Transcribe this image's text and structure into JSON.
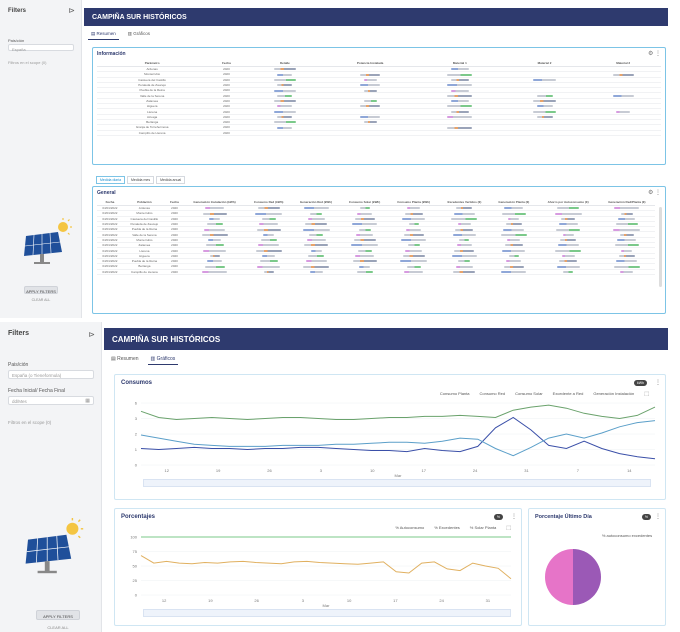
{
  "filters": {
    "title": "Filters",
    "collapse_icon": "chevron-left-icon",
    "pais_label": "Pais/ción",
    "pais_value": "España",
    "pais_tag": "España (o Tieneformula)",
    "fecha_label": "Fecha Inicial/ Fecha Final",
    "fecha_value": "dd/Mes",
    "filtro_link": "Filtros en el scope (0)",
    "apply_button": "APPLY FILTERS",
    "clear_button": "CLEAR ALL"
  },
  "dashboard": {
    "title": "CAMPIÑA SUR HISTÓRICOS",
    "tabs": [
      "Resumen",
      "Gráficos"
    ]
  },
  "informacion": {
    "title": "Información",
    "columns": [
      "Parámetro",
      "Fecha",
      "Detalle",
      "Potencia Instalada",
      "Material 1",
      "Material 2",
      "Material 3"
    ],
    "rows": [
      [
        "Ardenas",
        "2020",
        "a",
        "",
        "b",
        "",
        ""
      ],
      [
        "Monterrubio",
        "2020",
        "b",
        "a",
        "c",
        "",
        "a"
      ],
      [
        "Castuera del Castillo",
        "2020",
        "c",
        "d",
        "a",
        "b",
        ""
      ],
      [
        "Peraleda de Zaucejo",
        "2020",
        "a",
        "b",
        "b",
        "",
        ""
      ],
      [
        "Puebla de la Reina",
        "2020",
        "b",
        "a",
        "d",
        "",
        ""
      ],
      [
        "Valle de la Serena",
        "2020",
        "c",
        "",
        "a",
        "c",
        "b"
      ],
      [
        "Zalamea",
        "2020",
        "a",
        "c",
        "b",
        "a",
        ""
      ],
      [
        "Higuera",
        "2020",
        "d",
        "a",
        "c",
        "b",
        ""
      ],
      [
        "Llerena",
        "2020",
        "b",
        "",
        "a",
        "c",
        "d"
      ],
      [
        "Azuaga",
        "2020",
        "a",
        "b",
        "d",
        "a",
        ""
      ],
      [
        "Berlanga",
        "2020",
        "c",
        "a",
        "",
        "",
        ""
      ],
      [
        "Granja de Torrehermosa",
        "2020",
        "b",
        "",
        "a",
        "",
        ""
      ],
      [
        "Campillo de Llerena",
        "2020",
        "",
        "",
        "",
        "",
        ""
      ]
    ]
  },
  "subtabs": [
    "Medida diaria",
    "Medida mes",
    "Medida anual"
  ],
  "general": {
    "title": "General",
    "columns": [
      "Fecha",
      "Población",
      "Fecha",
      "Generación Instalación (kWh)",
      "Consumo Red (kWh)",
      "Generación Red (kWh)",
      "Consumo Solar (kWh)",
      "Consumo Planta (kWh)",
      "Excedentes Vertidos (€)",
      "Generación Planta (€)",
      "Ahorro por Autoconsumo (€)",
      "Generación Red/Planta (€)"
    ],
    "rows": [
      [
        "04/01/2022",
        "Ardenas",
        "2020"
      ],
      [
        "04/01/2022",
        "Monterrubio",
        "2020"
      ],
      [
        "04/01/2022",
        "Castuera del Castillo",
        "2020"
      ],
      [
        "04/01/2022",
        "Peraleda de Zaucejo",
        "2020"
      ],
      [
        "04/01/2022",
        "Puebla de la Reina",
        "2020"
      ],
      [
        "04/01/2022",
        "Valle de la Serena",
        "2020"
      ],
      [
        "04/01/2022",
        "Monterrubio",
        "2020"
      ],
      [
        "04/01/2022",
        "Zalamea",
        "2020"
      ],
      [
        "04/01/2022",
        "Llerena",
        "2020"
      ],
      [
        "04/01/2022",
        "Higuera",
        "2020"
      ],
      [
        "04/01/2022",
        "Puebla de la Reina",
        "2020"
      ],
      [
        "04/01/2022",
        "Berlanga",
        "2020"
      ],
      [
        "04/01/2022",
        "Campillo de Llerena",
        "2020"
      ]
    ]
  },
  "consumos": {
    "title": "Consumos",
    "legend": [
      "Consumo Planta",
      "Consumo Red",
      "Consumo Solar",
      "Excedente a Red",
      "Generación Instalación"
    ],
    "x_ticks": [
      "12",
      "19",
      "26",
      "3",
      "10",
      "17",
      "24",
      "31",
      "7",
      "14"
    ],
    "x_label": "Mar",
    "y_ticks": [
      "6",
      "3",
      "2",
      "1",
      "0"
    ],
    "badge": "kWh"
  },
  "porcentajes": {
    "title": "Porcentajes",
    "legend": [
      "% Autoconsumo",
      "% Excedentes",
      "% Solar Planta"
    ],
    "x_ticks": [
      "12",
      "19",
      "26",
      "3",
      "10",
      "17",
      "24",
      "31"
    ],
    "x_label": "Mar",
    "y_ticks": [
      "100",
      "75",
      "50",
      "25",
      "0"
    ],
    "badge": "%"
  },
  "pie": {
    "title": "Porcentaje Último Día",
    "badge": "%",
    "label_top": "% autoconsumo excedentes",
    "label_bottom": "% solar planta"
  },
  "chart_data": [
    {
      "type": "line",
      "title": "Consumos",
      "xlabel": "Mar",
      "x": [
        0,
        1,
        2,
        3,
        4,
        5,
        6,
        7,
        8,
        9,
        10,
        11,
        12,
        13,
        14,
        15,
        16,
        17,
        18,
        19,
        20,
        21,
        22,
        23,
        24,
        25,
        26,
        27,
        28,
        29
      ],
      "series": [
        {
          "name": "Consumo Planta",
          "color": "#6aa26c",
          "values": [
            5.2,
            4.6,
            4.4,
            4.5,
            4.6,
            4.5,
            4.4,
            4.5,
            4.6,
            4.6,
            4.5,
            4.4,
            4.4,
            4.5,
            4.6,
            4.6,
            4.7,
            4.7,
            4.8,
            4.7,
            4.6,
            5.3,
            5.6,
            5.8,
            5.5,
            5.0,
            4.7,
            4.5,
            4.8,
            5.6
          ]
        },
        {
          "name": "Consumo Red",
          "color": "#3a4fa8",
          "values": [
            1.6,
            1.5,
            1.6,
            1.7,
            1.6,
            1.6,
            1.5,
            1.6,
            1.6,
            1.7,
            1.7,
            1.6,
            1.5,
            1.4,
            1.4,
            1.3,
            1.6,
            1.4,
            1.3,
            1.8,
            3.6,
            4.6,
            3.4,
            1.9,
            1.6,
            2.3,
            1.6,
            1.1,
            0.8,
            0.6
          ]
        },
        {
          "name": "Consumo Solar",
          "color": "#5b9fc9",
          "values": [
            2.9,
            2.6,
            2.3,
            2.0,
            1.9,
            1.8,
            1.8,
            1.8,
            1.9,
            1.9,
            1.9,
            2.0,
            2.0,
            2.1,
            2.2,
            2.2,
            2.1,
            2.3,
            2.6,
            2.5,
            1.6,
            0.9,
            1.7,
            2.6,
            3.0,
            2.6,
            3.1,
            3.7,
            4.1,
            4.3
          ]
        }
      ]
    },
    {
      "type": "line",
      "title": "Porcentajes",
      "xlabel": "Mar",
      "x": [
        0,
        1,
        2,
        3,
        4,
        5,
        6,
        7,
        8,
        9,
        10,
        11,
        12,
        13,
        14,
        15,
        16,
        17,
        18,
        19,
        20,
        21,
        22,
        23,
        24,
        25,
        26,
        27,
        28,
        29
      ],
      "series": [
        {
          "name": "% Autoconsumo",
          "color": "#e0b060",
          "values": [
            68,
            55,
            58,
            55,
            54,
            56,
            55,
            57,
            58,
            56,
            55,
            54,
            57,
            58,
            56,
            55,
            54,
            53,
            55,
            57,
            40,
            38,
            55,
            57,
            45,
            42,
            55,
            50,
            46,
            28
          ]
        },
        {
          "name": "% Solar Planta",
          "color": "#7bc98a",
          "values": [
            100,
            100,
            100,
            100,
            100,
            100,
            100,
            100,
            100,
            100,
            100,
            100,
            100,
            100,
            100,
            100,
            100,
            100,
            100,
            100,
            100,
            100,
            100,
            100,
            100,
            100,
            100,
            100,
            100,
            100
          ]
        }
      ]
    },
    {
      "type": "pie",
      "title": "Porcentaje Último Día",
      "values": [
        50,
        50
      ],
      "colors": [
        "#9b59b6",
        "#e674c8"
      ]
    }
  ]
}
